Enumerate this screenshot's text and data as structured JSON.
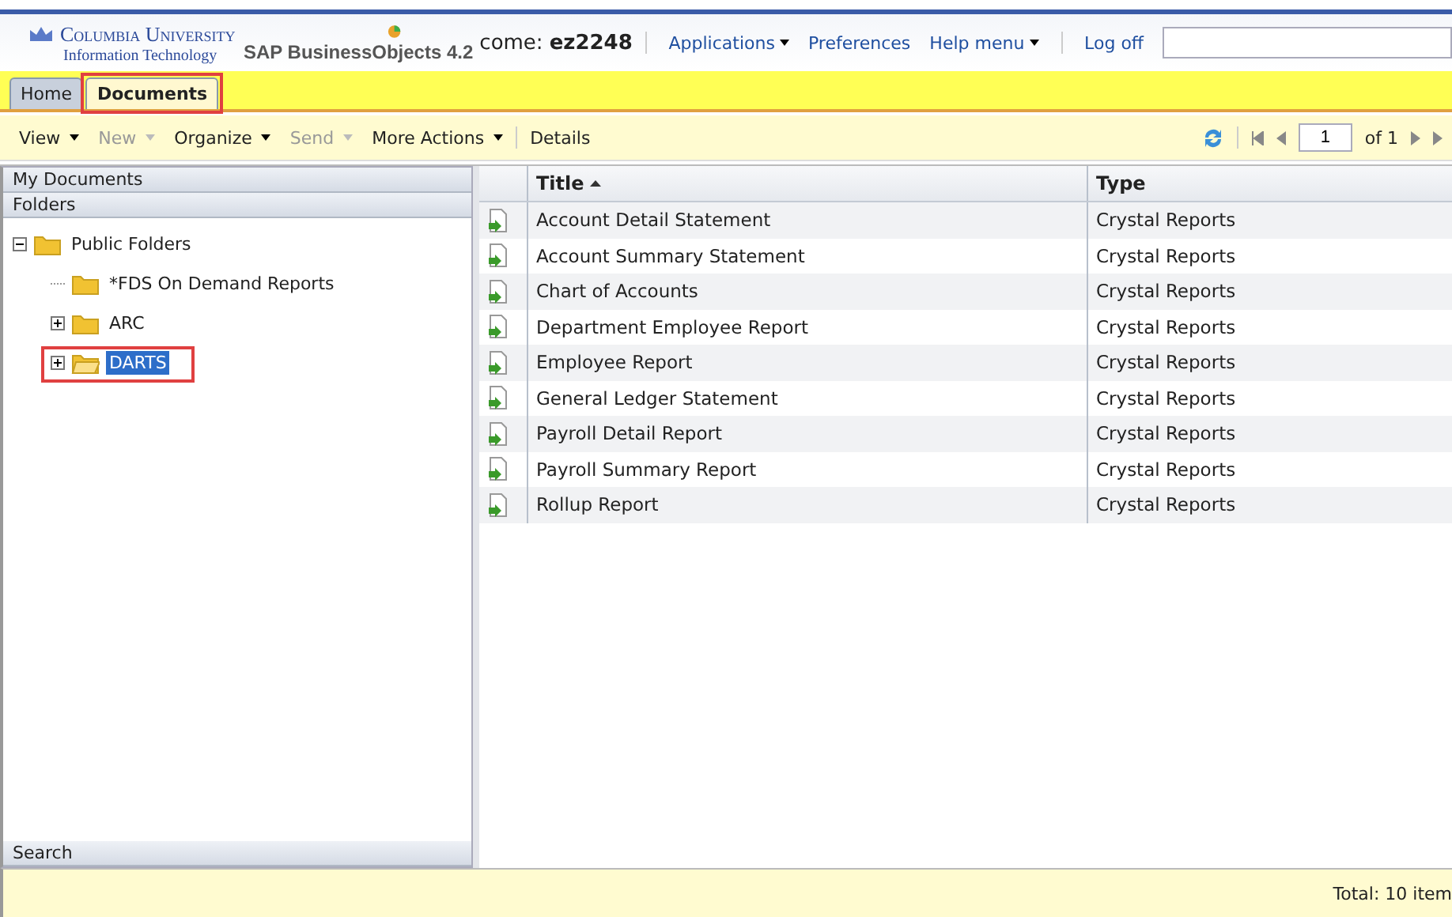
{
  "header": {
    "university": "Columbia University",
    "department": "Information Technology",
    "product": "SAP BusinessObjects 4.2",
    "welcome": "come:",
    "user": "ez2248",
    "links": [
      {
        "label": "Applications",
        "menu": true
      },
      {
        "label": "Preferences",
        "menu": false
      },
      {
        "label": "Help menu",
        "menu": true
      },
      {
        "label": "Log off",
        "menu": false
      }
    ]
  },
  "tabs": [
    {
      "label": "Home",
      "selected": false,
      "highlighted": false
    },
    {
      "label": "Documents",
      "selected": true,
      "highlighted": true
    }
  ],
  "toolbar": {
    "items": [
      {
        "label": "View",
        "disabled": false,
        "menu": true
      },
      {
        "label": "New",
        "disabled": true,
        "menu": true
      },
      {
        "label": "Organize",
        "disabled": false,
        "menu": true
      },
      {
        "label": "Send",
        "disabled": true,
        "menu": true
      },
      {
        "label": "More Actions",
        "disabled": false,
        "menu": true
      },
      {
        "label": "Details",
        "disabled": false,
        "menu": false
      }
    ],
    "page": "1",
    "of": "of 1"
  },
  "sidebar": {
    "sections": [
      "My Documents",
      "Folders"
    ],
    "tree": [
      {
        "label": "Public Folders",
        "expanded": true,
        "selected": false,
        "children": [
          {
            "label": "*FDS On Demand Reports",
            "selected": false,
            "leaf": true
          },
          {
            "label": "ARC",
            "expanded": false,
            "selected": false,
            "leaf": false
          },
          {
            "label": "DARTS",
            "expanded": false,
            "selected": true,
            "highlighted": true,
            "leaf": false
          }
        ]
      }
    ],
    "search": "Search"
  },
  "table": {
    "columns": [
      {
        "label": "Title",
        "sorted": true
      },
      {
        "label": "Type",
        "sorted": false
      }
    ],
    "rows": [
      [
        "Account Detail Statement",
        "Crystal Reports"
      ],
      [
        "Account Summary Statement",
        "Crystal Reports"
      ],
      [
        "Chart of Accounts",
        "Crystal Reports"
      ],
      [
        "Department Employee Report",
        "Crystal Reports"
      ],
      [
        "Employee Report",
        "Crystal Reports"
      ],
      [
        "General Ledger Statement",
        "Crystal Reports"
      ],
      [
        "Payroll Detail Report",
        "Crystal Reports"
      ],
      [
        "Payroll Summary Report",
        "Crystal Reports"
      ],
      [
        "Rollup Report",
        "Crystal Reports"
      ]
    ]
  },
  "status_bar": "Total: 10 item"
}
